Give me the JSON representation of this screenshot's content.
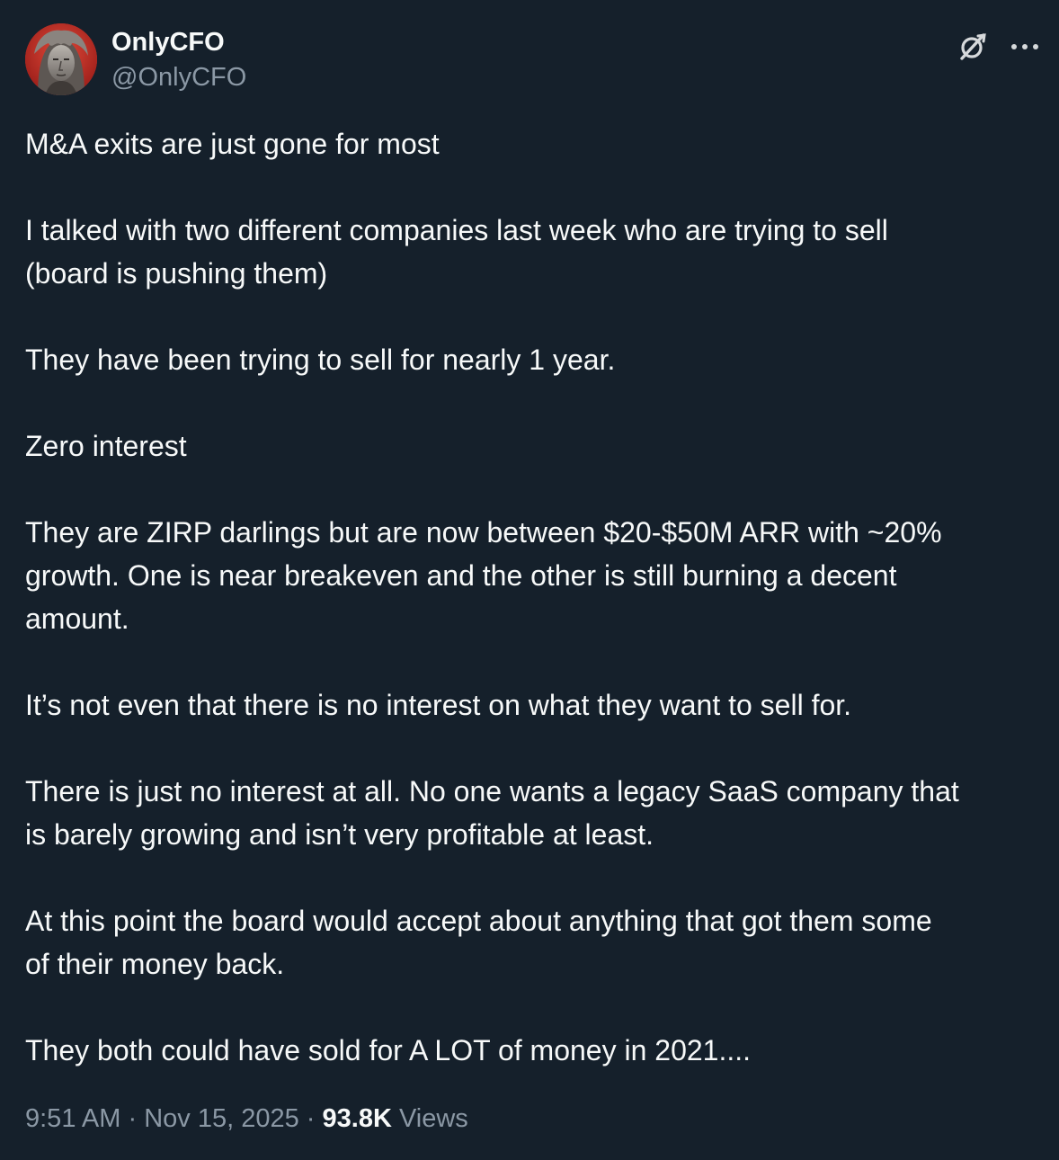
{
  "author": {
    "display_name": "OnlyCFO",
    "handle": "@OnlyCFO"
  },
  "header_icons": [
    "grok-icon",
    "more-icon"
  ],
  "body_paragraphs": [
    "M&A exits are just gone for most",
    "I talked with two different companies last week who are trying to sell\n(board is pushing them)",
    "They have been trying to sell for nearly 1 year.",
    "Zero interest",
    "They are ZIRP darlings but are now between $20-$50M ARR with ~20%\ngrowth. One is near breakeven and the other is still burning a decent\namount.",
    "It’s not even that there is no interest on what they want to sell for.",
    "There is just no interest at all. No one wants a legacy SaaS company that\nis barely growing and isn’t very profitable at least.",
    "At this point the board would accept about anything that got them some\nof their money back.",
    "They both could have sold for A LOT of money in 2021...."
  ],
  "meta": {
    "time": "9:51 AM",
    "separator": "·",
    "date": "Nov 15, 2025",
    "views_count": "93.8K",
    "views_label": "Views"
  },
  "colors": {
    "background": "#15202b",
    "text_primary": "#f7f9f9",
    "text_secondary": "#8b98a5",
    "avatar_ring": "#c9302c"
  }
}
